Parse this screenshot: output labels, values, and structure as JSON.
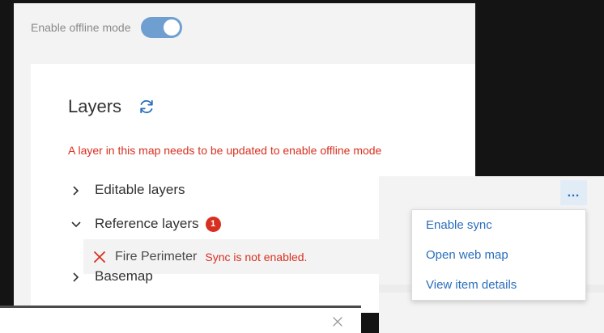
{
  "settings": {
    "offline_label": "Enable offline mode",
    "offline_enabled": true
  },
  "layers_card": {
    "title": "Layers",
    "warning": "A layer in this map needs to be updated to enable offline mode"
  },
  "tree": {
    "editable_label": "Editable layers",
    "reference_label": "Reference layers",
    "reference_badge": "1",
    "fire_name": "Fire Perimeter",
    "fire_error": "Sync is not enabled.",
    "basemap_label": "Basemap"
  },
  "context_menu": {
    "ellipsis": "…",
    "items": [
      {
        "label": "Enable sync"
      },
      {
        "label": "Open web map"
      },
      {
        "label": "View item details"
      }
    ]
  },
  "colors": {
    "accent": "#2a6ebb",
    "error": "#d83020",
    "toggle_on": "#6f9fd1"
  }
}
